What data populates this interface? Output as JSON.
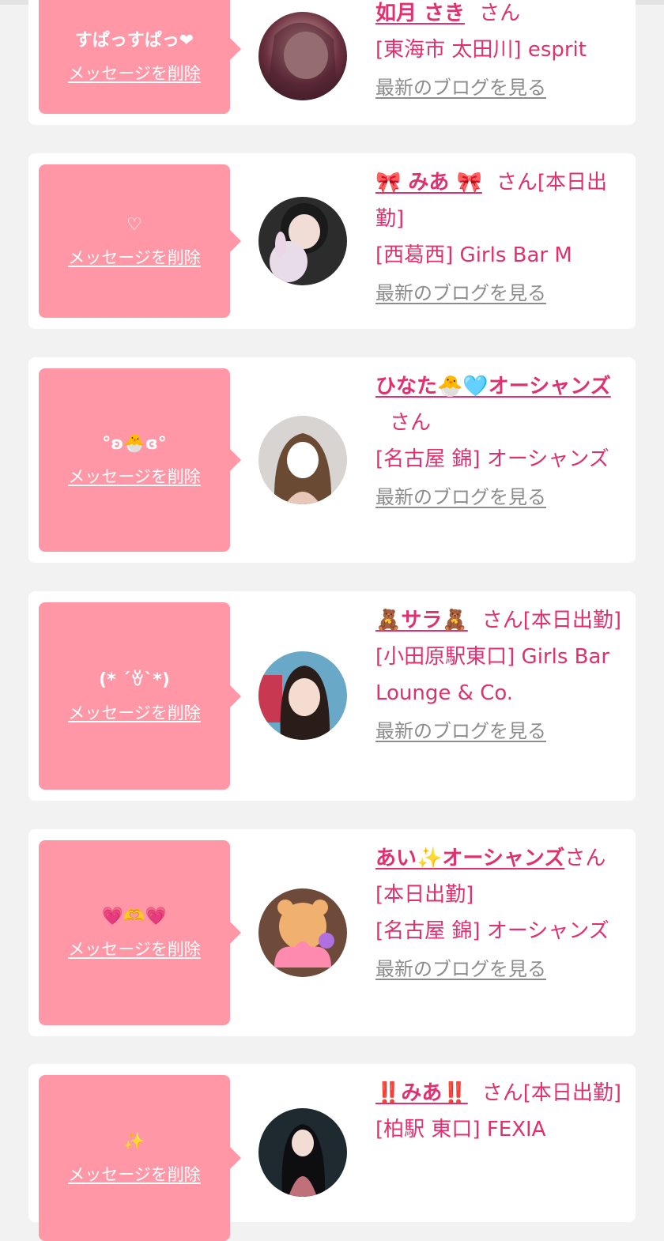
{
  "delete_label": "メッセージを削除",
  "blog_label": "最新のブログを見る",
  "san_label": "さん",
  "colors": {
    "bubble": "#ff97a7",
    "accent": "#e0306e",
    "link_gray": "#8c8c8c",
    "background": "#f2f2f2"
  },
  "entries": [
    {
      "message": "すぱっすぱっ❤",
      "name": "如月 さき",
      "status": "",
      "location": "[東海市 太田川] esprit"
    },
    {
      "message": "♡",
      "name": "🎀 みあ 🎀",
      "status": "[本日出勤]",
      "location": "[西葛西] Girls Bar M"
    },
    {
      "message": "°ʚ🐣ɞ°",
      "name": "ひなた🐣🩵オーシャンズ",
      "status": "",
      "location": "[名古屋 錦] オーシャンズ"
    },
    {
      "message": "(* ´ꈊ`*)",
      "name": "🧸サラ🧸",
      "status": "[本日出勤]",
      "location": "[小田原駅東口] Girls Bar Lounge & Co."
    },
    {
      "message": "💗🫶💗",
      "name": "あい✨オーシャンズ",
      "status": "[本日出勤]",
      "location": "[名古屋 錦] オーシャンズ"
    },
    {
      "message": "✨",
      "name": "‼️みあ‼️",
      "status": "[本日出勤]",
      "location": "[柏駅 東口] FEXIA"
    }
  ]
}
